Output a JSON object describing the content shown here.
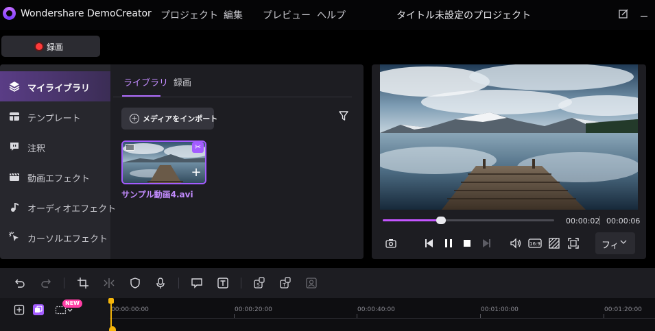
{
  "app": {
    "name": "Wondershare DemoCreator"
  },
  "menu": [
    "プロジェクト",
    "編集",
    "プレビュー",
    "ヘルプ"
  ],
  "project_title": "タイトル未設定のプロジェクト",
  "titlebar_icons": [
    "feedback-icon",
    "minimize-icon"
  ],
  "record": {
    "label": "録画"
  },
  "sidebar": {
    "items": [
      {
        "label": "マイライブラリ",
        "icon": "layers-icon",
        "active": true
      },
      {
        "label": "テンプレート",
        "icon": "template-icon",
        "active": false
      },
      {
        "label": "注釈",
        "icon": "annotation-icon",
        "active": false
      },
      {
        "label": "動画エフェクト",
        "icon": "video-effect-icon",
        "active": false
      },
      {
        "label": "オーディオエフェクト",
        "icon": "audio-effect-icon",
        "active": false
      },
      {
        "label": "カーソルエフェクト",
        "icon": "cursor-effect-icon",
        "active": false
      }
    ]
  },
  "library": {
    "tabs": [
      {
        "label": "ライブラリ",
        "active": true
      },
      {
        "label": "録画",
        "active": false
      }
    ],
    "import_label": "メディアをインポート",
    "media": [
      {
        "name": "サンプル動画4.avi"
      }
    ]
  },
  "preview": {
    "progress": 0.34,
    "time_current": "00:00:02",
    "time_total": "00:00:06",
    "fit_label": "フィット",
    "controls": [
      "screenshot-icon",
      "step-back-icon",
      "pause-icon",
      "stop-icon",
      "step-forward-icon",
      "volume-icon",
      "aspect-ratio-icon",
      "transparent-bg-icon",
      "fullscreen-icon"
    ]
  },
  "timeline": {
    "new_badge": "NEW",
    "ticks": [
      "00:00:00:00",
      "00:00:20:00",
      "00:00:40:00",
      "00:01:00:00",
      "00:01:20:00"
    ]
  },
  "colors": {
    "accent": "#b06cff",
    "record": "#ff3a3a",
    "playhead": "#f5b50a",
    "badge": "#ff3ea5"
  }
}
